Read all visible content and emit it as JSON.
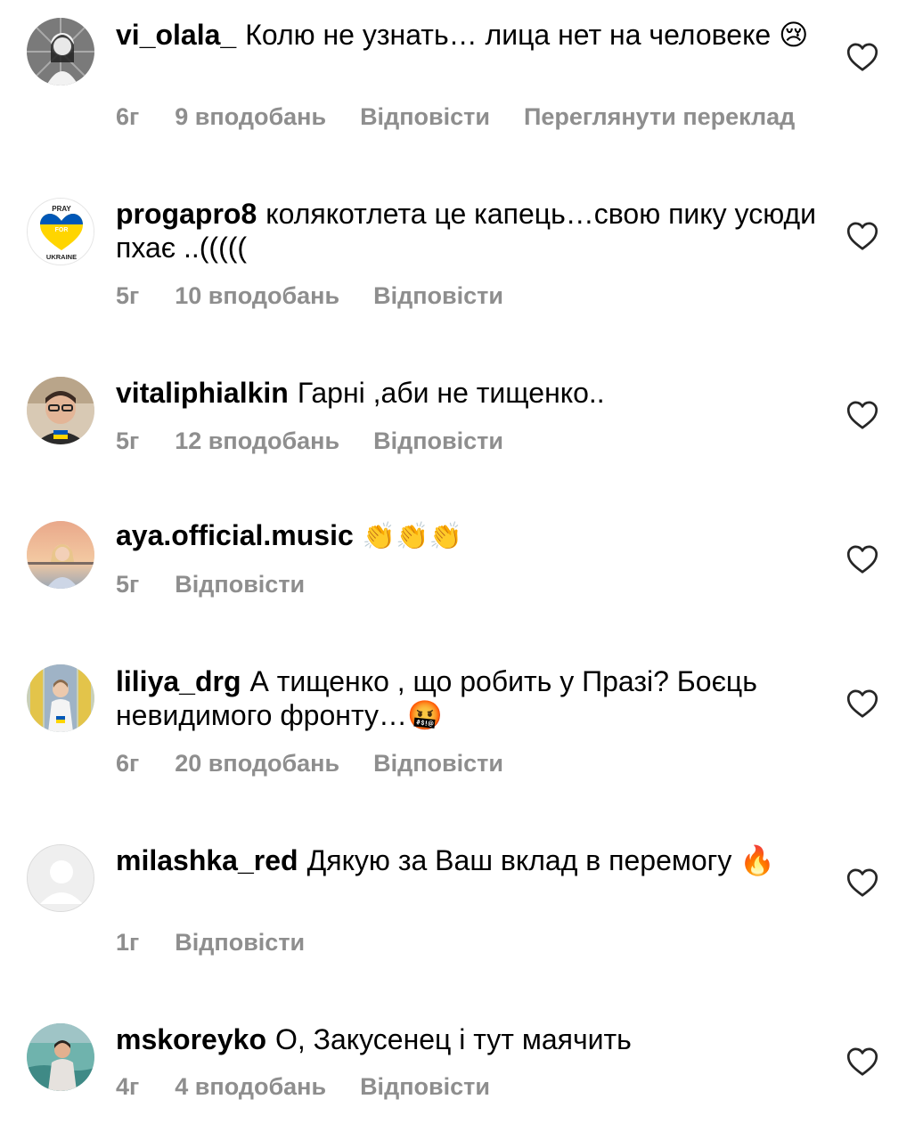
{
  "comments": [
    {
      "user": "vi_olala_",
      "text": "Колю не узнать… лица нет на человеке 😢",
      "time": "6г",
      "likes": "9 вподобань",
      "reply": "Відповісти",
      "translate": "Переглянути переклад"
    },
    {
      "user": "progapro8",
      "text": "колякотлета це капець…свою пику усюди пхає ..(((((",
      "time": "5г",
      "likes": "10 вподобань",
      "reply": "Відповісти",
      "avatar_text": [
        "PRAY",
        "FOR",
        "UKRAINE"
      ]
    },
    {
      "user": "vitaliphialkin",
      "text": "Гарні ,аби не тищенко..",
      "time": "5г",
      "likes": "12 вподобань",
      "reply": "Відповісти"
    },
    {
      "user": "aya.official.music",
      "text": "👏👏👏",
      "time": "5г",
      "reply": "Відповісти"
    },
    {
      "user": "liliya_drg",
      "text": "А тищенко , що робить у Празі? Боєць невидимого фронту…🤬",
      "time": "6г",
      "likes": "20 вподобань",
      "reply": "Відповісти"
    },
    {
      "user": "milashka_red",
      "text": "Дякую за Ваш вклад в перемогу 🔥",
      "time": "1г",
      "reply": "Відповісти"
    },
    {
      "user": "mskoreyko",
      "text": "О, Закусенец і тут маячить",
      "time": "4г",
      "likes": "4 вподобань",
      "reply": "Відповісти"
    }
  ],
  "colors": {
    "meta": "#8e8e8e",
    "heart": "#262626"
  },
  "icons": {
    "like": "heart-outline-icon"
  }
}
